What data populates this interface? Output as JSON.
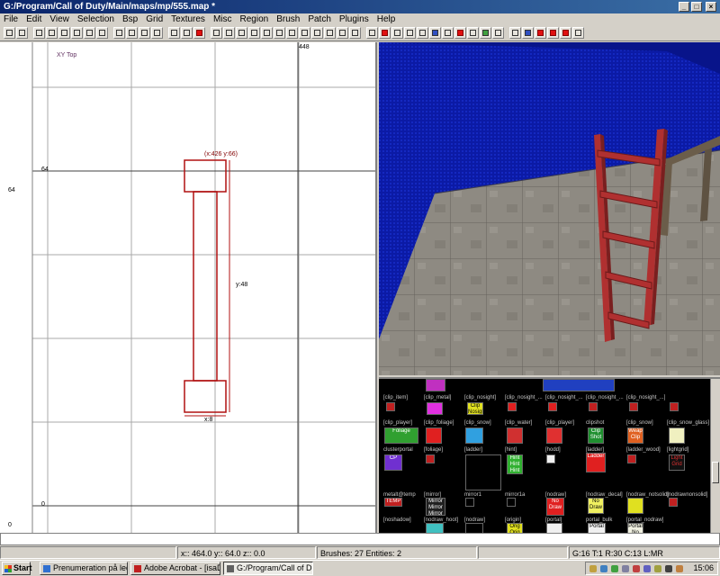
{
  "window": {
    "title": "G:/Program/Call of Duty/Main/maps/mp/555.map *",
    "minimize": "_",
    "maximize": "□",
    "close": "×"
  },
  "menu": [
    "File",
    "Edit",
    "View",
    "Selection",
    "Bsp",
    "Grid",
    "Textures",
    "Misc",
    "Region",
    "Brush",
    "Patch",
    "Plugins",
    "Help"
  ],
  "xy_view": {
    "label": "XY Top",
    "top_ruler_value": "448",
    "left_ruler": [
      "64",
      "0"
    ],
    "inner_ruler": [
      "64",
      "0"
    ],
    "sel_coords": "(x:426  y:66)",
    "height_label": "y:48",
    "width_label": "x:8"
  },
  "textures": {
    "names_row1": [
      "[clip_item]",
      "[clip_metal]",
      "[clip_nosight]",
      "[clip_nosight_...",
      "[clip_nosight_...",
      "[clip_nosight_...",
      "[clip_nosight_...]"
    ],
    "names_row2": [
      "[clip_player]",
      "[clip_foliage]",
      "[clip_snow]",
      "[clip_water]",
      "[clip_player]",
      "clipshot",
      "[clip_snow]",
      "[clip_snow_glass]"
    ],
    "names_row3": [
      "clusterportal",
      "[foliage]",
      "[ladder]",
      "[hint]",
      "[hodd]",
      "[ladder]",
      "[ladder_wood]",
      "[lightgrid]"
    ],
    "names_row4": [
      "metalt@temp",
      "[mirror]",
      "mirror1",
      "mirror1a",
      "[nodraw]",
      "[nodraw_decal]",
      "[nodraw_notsolid]",
      "[nodrawnonsolid]"
    ],
    "names_row5": [
      "[noshadow]",
      "[nodraw_hoot]",
      "[nodraw]",
      "[origin]",
      "[portal]",
      "portal_bulk",
      "[portal_nodraw]"
    ],
    "swatch_text": {
      "clip_nosight": "Clip Nosight Clip",
      "foliage": "Foliage",
      "cp": "CP",
      "clipshot": "Clip Shot",
      "weapclip": "Weap Clip",
      "hint": "Hint Hint Hint",
      "ladder": "Ladder",
      "light": "Light Grid",
      "mirror": "Mirror Mirror Mirror",
      "nodraw": "No Draw",
      "nodraw2": "No Draw",
      "temp": "TEMP",
      "portal": "Portal",
      "portal_nodraw": "Portal No Draw",
      "origin": "Orig Orig"
    }
  },
  "status": {
    "coords": "x::  464.0  y::  64.0  z::  0.0",
    "counts": "Brushes: 27  Entities: 2",
    "grid": "G:16 T:1 R:30 C:13 L:MR"
  },
  "taskbar": {
    "start": "Start",
    "tasks": [
      "Prenumeration på lediga ...",
      "Adobe Acrobat - [isaDor...",
      "G:/Program/Call of D..."
    ],
    "clock": "15:06"
  },
  "colors": {
    "brush_outline": "#b01010",
    "grid_major": "#a8a8a8",
    "grid_minor": "#d8d8d8",
    "cam_sky": "#0a1a9a",
    "ladder": "#b03030",
    "title_gradient_start": "#0a246a"
  }
}
